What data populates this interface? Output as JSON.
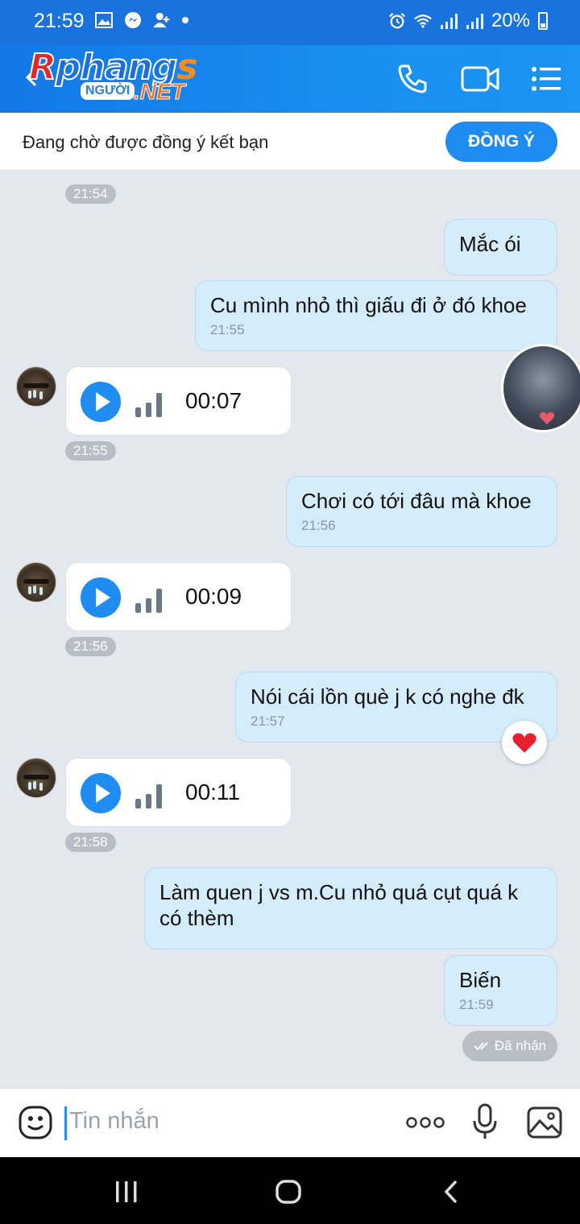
{
  "status_bar": {
    "time": "21:59",
    "battery": "20%",
    "left_icons": [
      "gallery-icon",
      "messenger-icon",
      "add-contact-icon",
      "dot-icon"
    ],
    "right_icons": [
      "alarm-icon",
      "wifi-icon",
      "signal-icon",
      "signal-icon",
      "battery-icon"
    ]
  },
  "header": {
    "logo": {
      "main": "Rphangs",
      "sub": "NGƯỜI",
      "net": ".NET"
    },
    "icons": [
      "back-arrow-icon",
      "phone-icon",
      "video-call-icon",
      "menu-icon"
    ]
  },
  "friend_request": {
    "text": "Đang chờ được đồng ý kết bạn",
    "button": "ĐỒNG Ý"
  },
  "messages": {
    "ts1": "21:54",
    "m1": {
      "text": "Mắc ói"
    },
    "m2": {
      "text": "Cu mình nhỏ thì giấu đi ở đó khoe",
      "time": "21:55"
    },
    "v1": {
      "duration": "00:07",
      "time": "21:55"
    },
    "m3": {
      "text": "Chơi có tới đâu mà khoe",
      "time": "21:56"
    },
    "v2": {
      "duration": "00:09",
      "time": "21:56"
    },
    "m4": {
      "text": "Nói cái lồn què j k có nghe đk",
      "time": "21:57"
    },
    "v3": {
      "duration": "00:11",
      "time": "21:58"
    },
    "m5": {
      "text": "Làm quen j vs m.Cu nhỏ quá cụt quá k có thèm"
    },
    "m6": {
      "text": "Biến",
      "time": "21:59"
    },
    "status": "Đã nhận"
  },
  "input": {
    "placeholder": "Tin nhắn",
    "icons": [
      "emoji-icon",
      "more-icon",
      "microphone-icon",
      "image-icon"
    ]
  },
  "nav": {
    "icons": [
      "recent-apps-icon",
      "home-icon",
      "back-icon"
    ]
  },
  "colors": {
    "accent": "#1e8cf0",
    "bubble": "#d4ecfb",
    "chat_bg": "#e3e8ef"
  }
}
